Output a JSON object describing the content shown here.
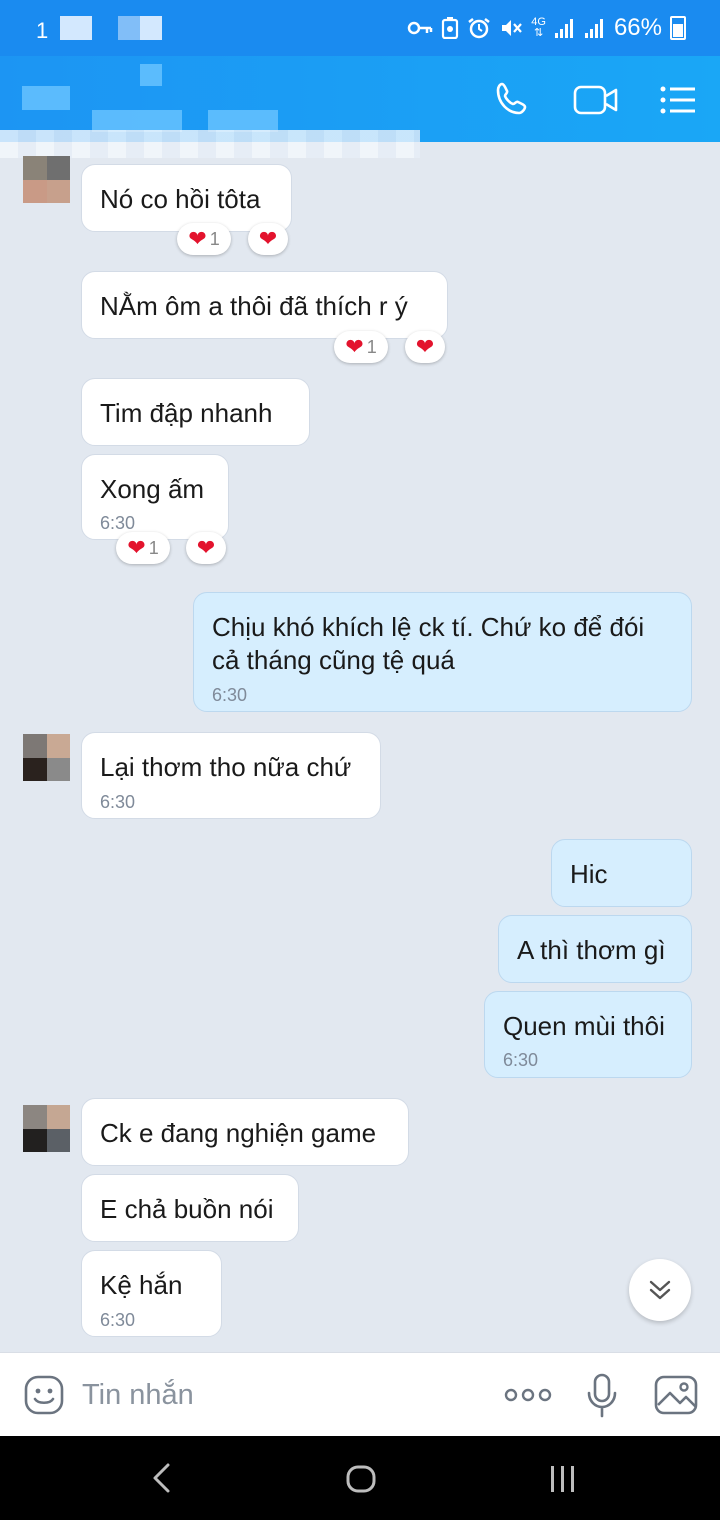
{
  "status_bar": {
    "time": "1",
    "network": "4G",
    "battery": "66%"
  },
  "header": {
    "call_icon": "phone-icon",
    "video_icon": "video-camera-icon",
    "menu_icon": "menu-icon"
  },
  "messages": [
    {
      "direction": "in",
      "text": "Nó co hồi tôta",
      "reaction_count": "1"
    },
    {
      "direction": "in",
      "text": "NẰm ôm a thôi đã thích r ý",
      "reaction_count": "1"
    },
    {
      "direction": "in",
      "text": "Tim đập nhanh"
    },
    {
      "direction": "in",
      "text": "Xong ấm",
      "time": "6:30",
      "reaction_count": "1"
    },
    {
      "direction": "out",
      "text_line1": "Chịu khó khích lệ ck tí. Chứ ko để đói",
      "text_line2": "cả tháng cũng tệ quá",
      "time": "6:30"
    },
    {
      "direction": "in",
      "text": "Lại thơm tho nữa chứ",
      "time": "6:30"
    },
    {
      "direction": "out",
      "text": "Hic"
    },
    {
      "direction": "out",
      "text": "A thì thơm gì"
    },
    {
      "direction": "out",
      "text": "Quen mùi thôi",
      "time": "6:30"
    },
    {
      "direction": "in",
      "text": "Ck e đang nghiện game"
    },
    {
      "direction": "in",
      "text": "E chả buồn nói"
    },
    {
      "direction": "in",
      "text": "Kệ hắn",
      "time": "6:30"
    }
  ],
  "input": {
    "placeholder": "Tin nhắn"
  },
  "colors": {
    "header": "#1a8bf0",
    "chat_background": "#e2e8f0",
    "outgoing_bubble": "#d6eefe",
    "heart": "#e3132d"
  }
}
